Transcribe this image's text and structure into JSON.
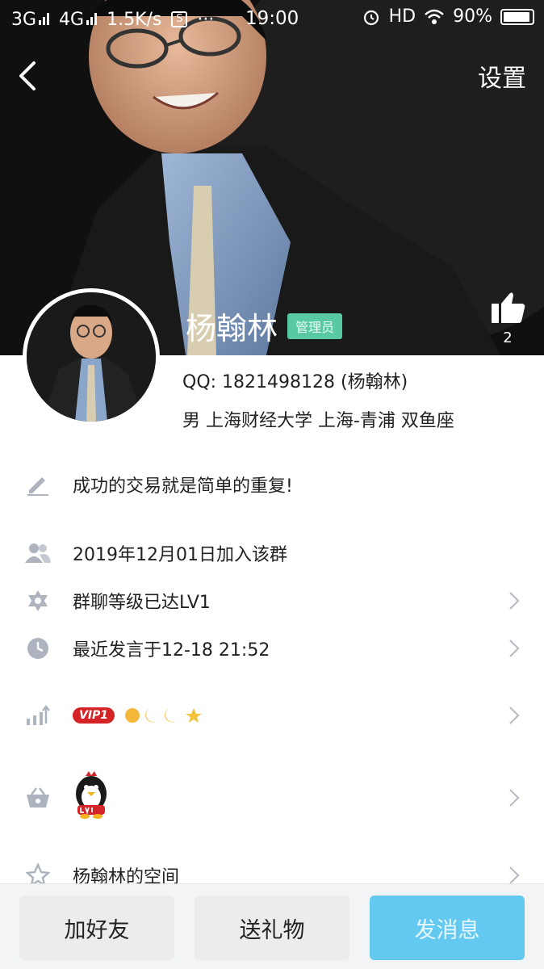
{
  "status_bar": {
    "network1": "3G",
    "network2": "4G",
    "speed": "1.5K/s",
    "dots": "···",
    "time": "19:00",
    "hd": "HD",
    "battery": "90%"
  },
  "header": {
    "settings_label": "设置",
    "name": "杨翰林",
    "role_badge": "管理员",
    "like_count": "2"
  },
  "profile": {
    "qq_line": "QQ:  1821498128 (杨翰林)",
    "meta_line": "男  上海财经大学  上海-青浦  双鱼座"
  },
  "rows": {
    "signature": "成功的交易就是简单的重复!",
    "joined": "2019年12月01日加入该群",
    "group_level": "群聊等级已达LV1",
    "last_spoke": "最近发言于12-18 21:52",
    "vip_label": "VIP1",
    "qzone": "杨翰林的空间"
  },
  "bottom": {
    "add_friend": "加好友",
    "send_gift": "送礼物",
    "send_message": "发消息"
  },
  "colors": {
    "accent": "#64c9f0",
    "badge": "#59c9a4",
    "vip": "#d52427"
  }
}
